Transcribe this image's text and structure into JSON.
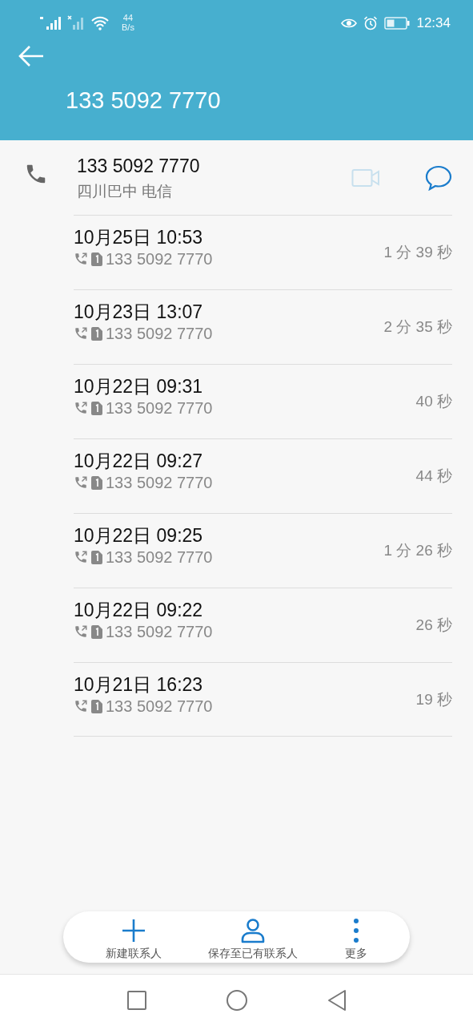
{
  "status_bar": {
    "speed_value": "44",
    "speed_unit": "B/s",
    "time": "12:34"
  },
  "header": {
    "title": "133 5092 7770"
  },
  "contact": {
    "number": "133 5092 7770",
    "location": "四川巴中 电信",
    "actions": [
      {
        "kind": "video",
        "disabled": true
      },
      {
        "kind": "message",
        "disabled": false
      }
    ]
  },
  "calls": [
    {
      "datetime": "10月25日 10:53",
      "number": "133 5092 7770",
      "duration": "1 分 39 秒"
    },
    {
      "datetime": "10月23日 13:07",
      "number": "133 5092 7770",
      "duration": "2 分 35 秒"
    },
    {
      "datetime": "10月22日 09:31",
      "number": "133 5092 7770",
      "duration": "40 秒"
    },
    {
      "datetime": "10月22日 09:27",
      "number": "133 5092 7770",
      "duration": "44 秒"
    },
    {
      "datetime": "10月22日 09:25",
      "number": "133 5092 7770",
      "duration": "1 分 26 秒"
    },
    {
      "datetime": "10月22日 09:22",
      "number": "133 5092 7770",
      "duration": "26 秒"
    },
    {
      "datetime": "10月21日 16:23",
      "number": "133 5092 7770",
      "duration": "19 秒"
    }
  ],
  "bottom_actions": [
    {
      "kind": "add",
      "label": "新建联系人"
    },
    {
      "kind": "person",
      "label": "保存至已有联系人"
    },
    {
      "kind": "more",
      "label": "更多"
    }
  ]
}
